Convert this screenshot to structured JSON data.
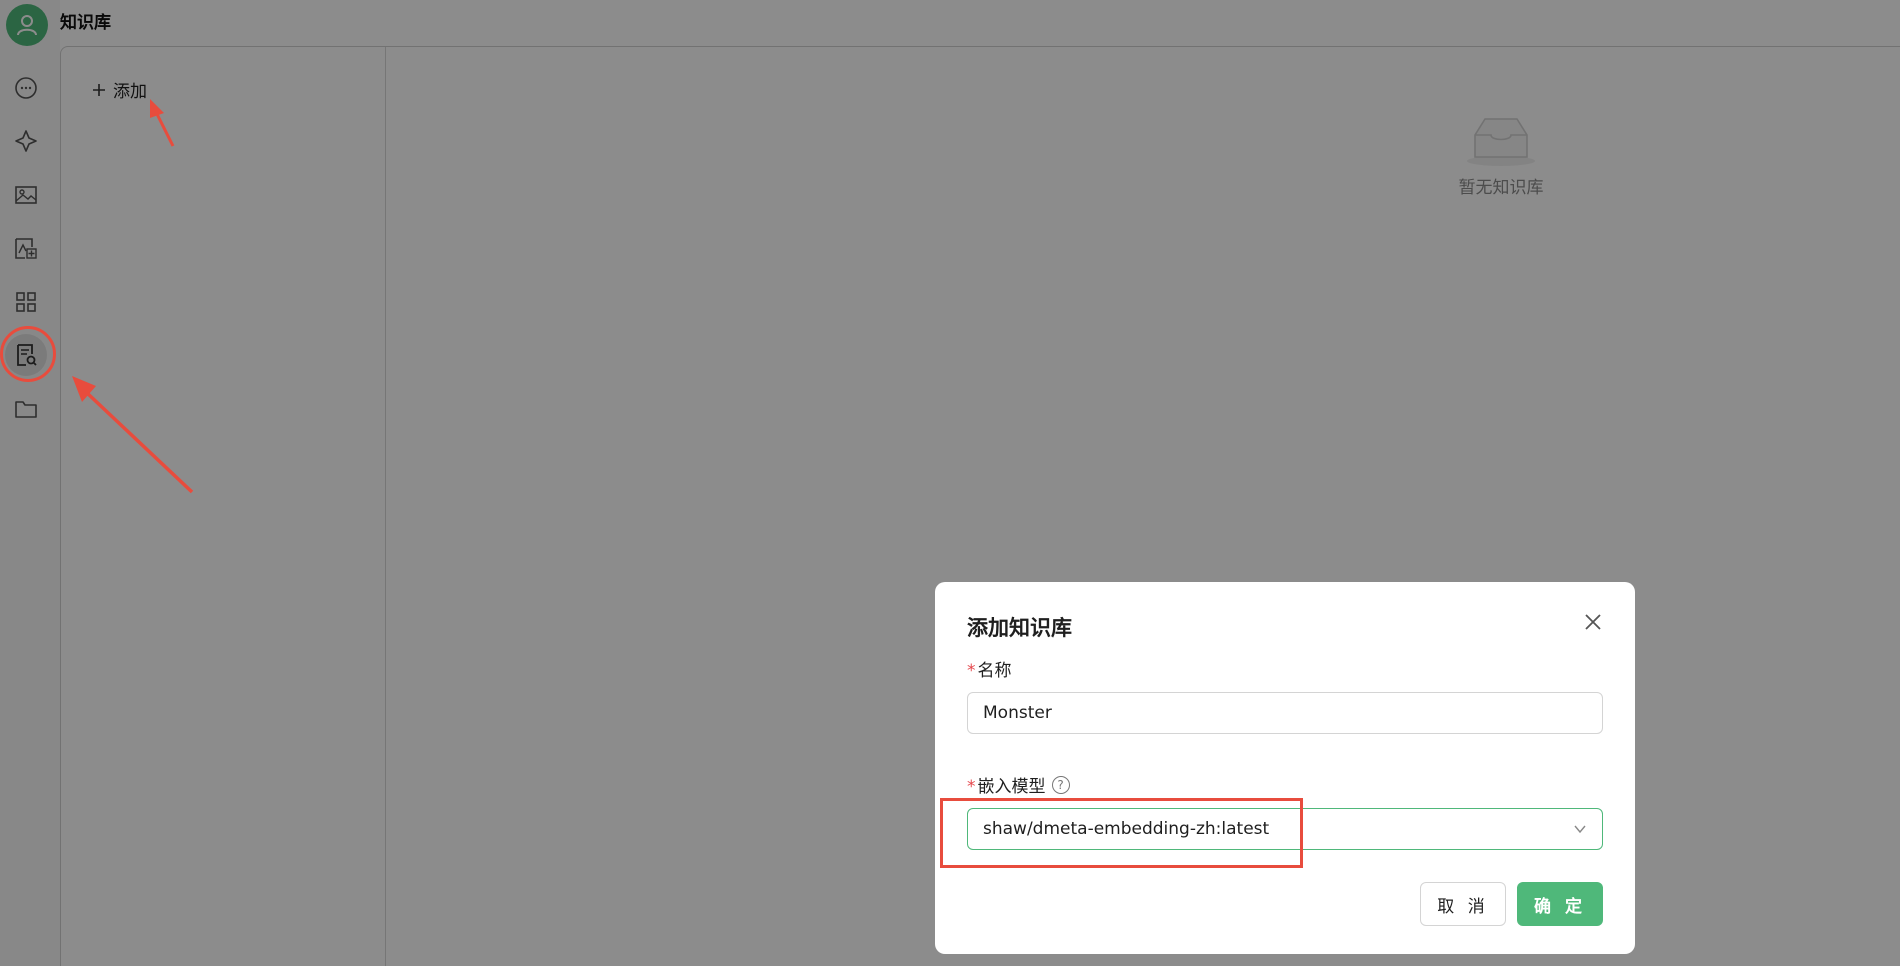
{
  "app": {
    "title": "知识库"
  },
  "sidebar": {
    "items": [
      {
        "name": "chat-icon"
      },
      {
        "name": "sparkle-icon"
      },
      {
        "name": "image-icon"
      },
      {
        "name": "image-edit-icon"
      },
      {
        "name": "apps-grid-icon"
      },
      {
        "name": "knowledge-base-icon",
        "active": true
      },
      {
        "name": "folder-icon"
      }
    ]
  },
  "main": {
    "add_label": "添加",
    "empty_text": "暂无知识库"
  },
  "modal": {
    "title": "添加知识库",
    "name_label": "名称",
    "name_value": "Monster",
    "embed_label": "嵌入模型",
    "embed_value": "shaw/dmeta-embedding-zh:latest",
    "cancel_label": "取 消",
    "ok_label": "确 定",
    "required_mark": "*"
  },
  "colors": {
    "accent": "#4fb87a",
    "annotation": "#e84c3d"
  }
}
